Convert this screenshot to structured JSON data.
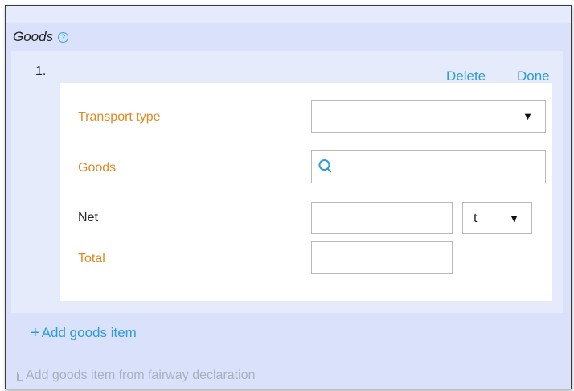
{
  "section": {
    "title": "Goods",
    "help_icon": "question-circle-icon",
    "help_glyph": "?"
  },
  "item": {
    "number": "1.",
    "delete_label": "Delete",
    "done_label": "Done"
  },
  "form": {
    "transport_type_label": "Transport type",
    "transport_type_value": "",
    "goods_label": "Goods",
    "goods_value": "",
    "net_label": "Net",
    "net_value": "",
    "net_unit": "t",
    "total_label": "Total",
    "total_value": "",
    "dropdown_icon": "triangle-down-icon",
    "dropdown_glyph": "▼",
    "search_icon": "search-icon"
  },
  "actions": {
    "add_plus": "+",
    "add_goods_item": "Add goods item",
    "add_from_fairway": "Add goods item from fairway declaration",
    "fairway_icon": "document-icon"
  },
  "colors": {
    "accent_blue": "#2f9bd6",
    "label_orange": "#e08a26",
    "panel_bg": "#d9e1fb",
    "item_bg": "#e6ebfc",
    "disabled_text": "#a9b0bf"
  }
}
